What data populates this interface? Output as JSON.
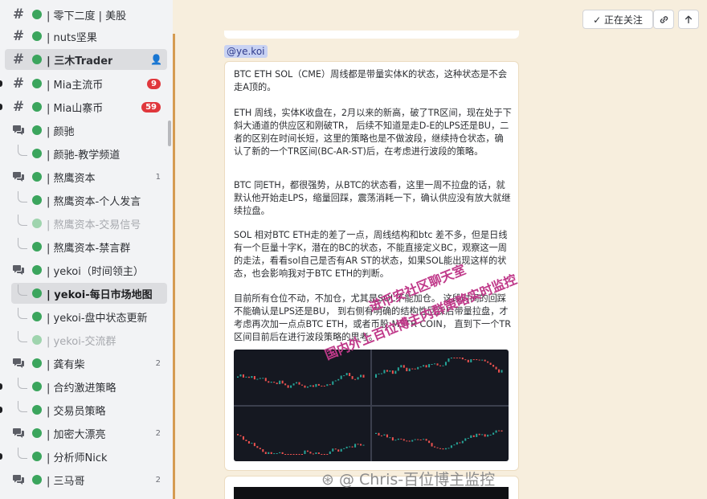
{
  "sidebar": {
    "channels": [
      {
        "label": "| 零下二度 | 美股",
        "icon": "hash-icon",
        "dot": true
      },
      {
        "label": "| nuts坚果",
        "icon": "hash-icon",
        "dot": true
      },
      {
        "label": "| 三木Trader",
        "icon": "hash-icon",
        "dot": true,
        "active": true
      },
      {
        "label": "| Mia主流币",
        "icon": "hash-icon",
        "dot": true,
        "badge": "9"
      },
      {
        "label": "| Mia山寨币",
        "icon": "hash-icon",
        "dot": true,
        "badge": "59"
      },
      {
        "label": "| 颜驰",
        "icon": "forum-icon",
        "dot": true
      },
      {
        "label": "| 颜驰-教学频道",
        "dot": true,
        "child": true
      },
      {
        "label": "| 熬鹰资本",
        "icon": "forum-icon",
        "dot": true,
        "count": "1"
      },
      {
        "label": "| 熬鹰资本-个人发言",
        "dot": true,
        "child": true
      },
      {
        "label": "| 熬鹰资本-交易信号",
        "dot": true,
        "child": true,
        "dim": true
      },
      {
        "label": "| 熬鹰资本-禁言群",
        "dot": true,
        "child": true
      },
      {
        "label": "| yekoi（时间领主）",
        "icon": "forum-icon",
        "dot": true
      },
      {
        "label": "| yekoi-每日市场地图",
        "dot": true,
        "child": true,
        "selected": true
      },
      {
        "label": "| yekoi-盘中状态更新",
        "dot": true,
        "child": true
      },
      {
        "label": "| yekoi-交流群",
        "dot": true,
        "child": true,
        "dim": true
      },
      {
        "label": "| 龚有柴",
        "icon": "forum-icon",
        "dot": true,
        "count": "2"
      },
      {
        "label": "| 合约激进策略",
        "dot": true,
        "child": true
      },
      {
        "label": "| 交易员策略",
        "dot": true,
        "child": true
      },
      {
        "label": "| 加密大漂亮",
        "icon": "forum-icon",
        "dot": true,
        "count": "2"
      },
      {
        "label": "| 分析师Nick",
        "dot": true,
        "child": true
      },
      {
        "label": "| 三马哥",
        "icon": "forum-icon",
        "dot": true,
        "count": "2"
      }
    ]
  },
  "topbar": {
    "follow_label": "✓ 正在关注",
    "link_icon": "link-icon",
    "up_icon": "arrow-up-icon"
  },
  "message": {
    "mention": "@ye.koi",
    "paragraphs": [
      "BTC ETH SOL（CME）周线都是带量实体K的状态，这种状态是不会走A顶的。",
      "ETH 周线，实体K收盘在，2月以来的新高，破了TR区间，现在处于下斜大通道的供应区和刚破TR， 后续不知道是走D-E的LPS还是BU，二者的区别在时间长短，这里的策略也是不做波段，继续持仓状态，确认了新的一个TR区间(BC-AR-ST)后，在考虑进行波段的策略。",
      "BTC 同ETH，都很强势，从BTC的状态看，这里一周不拉盘的话，就默认他开始走LPS，缩量回踩，震荡消耗一下，确认供应没有放大就继续拉盘。",
      "SOL 相对BTC ETH走的差了一点，周线结构和btc 差不多，但是日线有一个巨量十字K，潜在的BC的状态，不能直接定义BC，观察这一周的走法，看看sol自己是否有AR ST的状态，如果SOL能出现这样的状态，也会影响我对于BTC ETH的判断。",
      "目前所有仓位不动，不加仓，尤其是SOL不能加仓。 这段时间的回踩不能确认是LPS还是BU， 到右侧有明确的结构性回踩后带量拉盘，才考虑再次加一点点BTC ETH，或者币股 MSTR COIN， 直到下一个TR区间目前后在进行波段策略的思考。"
    ]
  },
  "watermark": {
    "line1": "进币安社区聊天室",
    "line2": "国内外上百位博主内群策略实时监控",
    "footer": "⊛ @ Chris-百位博主监控"
  },
  "colors": {
    "online": "#3ba55d",
    "badge": "#e0373c",
    "accent_bar": "#d59b51",
    "watermark": "#c03a8a"
  }
}
